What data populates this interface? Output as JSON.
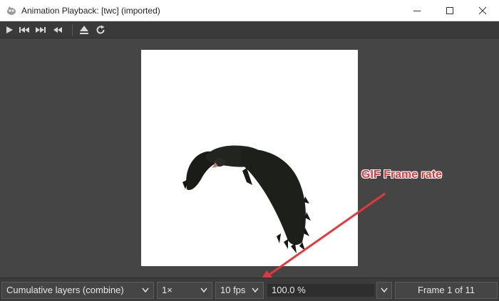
{
  "window": {
    "title": "Animation Playback: [twc] (imported)",
    "controls": [
      "minimize-icon",
      "maximize-icon",
      "close-icon"
    ]
  },
  "toolbar": {
    "buttons": [
      "play-icon",
      "rewind-to-start-icon",
      "skip-to-end-icon",
      "step-back-icon",
      "detach-icon",
      "reload-icon"
    ]
  },
  "canvas": {
    "frame_background": "#ffffff",
    "image": "flying eagle (bird) frame"
  },
  "statusbar": {
    "layer_mode": "Cumulative layers (combine)",
    "speed": "1×",
    "frame_rate": "10 fps",
    "zoom": "100.0 %",
    "frame_counter": "Frame 1 of 11"
  },
  "annotation": {
    "label": "GIF Frame rate",
    "color": "#e1393b"
  }
}
